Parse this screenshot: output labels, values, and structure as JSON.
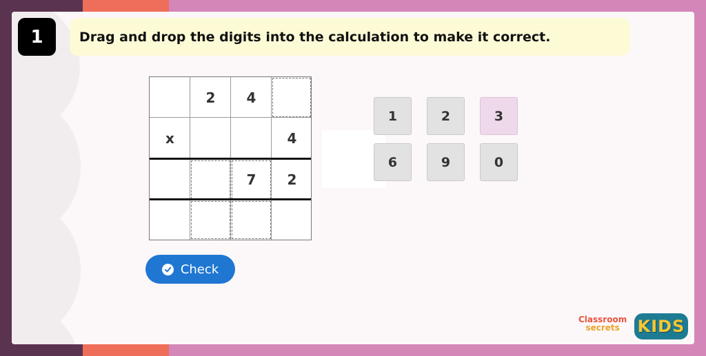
{
  "question": {
    "number": "1",
    "instruction": "Drag and drop the digits into the calculation to make it correct."
  },
  "grid": {
    "rows": [
      [
        "",
        "2",
        "4",
        ""
      ],
      [
        "x",
        "",
        "",
        "4"
      ],
      [
        "",
        "",
        "7",
        "2"
      ],
      [
        "",
        "",
        "",
        ""
      ]
    ]
  },
  "tiles": [
    "1",
    "2",
    "3",
    "6",
    "9",
    "0"
  ],
  "selected_tile": "3",
  "check_button": {
    "label": "Check"
  },
  "logos": {
    "classroom_line1": "Classroom",
    "classroom_line2": "secrets",
    "kids": "KIDS"
  },
  "colors": {
    "accent_blue": "#1f77d2",
    "instruction_bg": "#fdfbd6",
    "tile_bg": "#e2e2e2",
    "tile_selected_bg": "#edd9ea"
  }
}
